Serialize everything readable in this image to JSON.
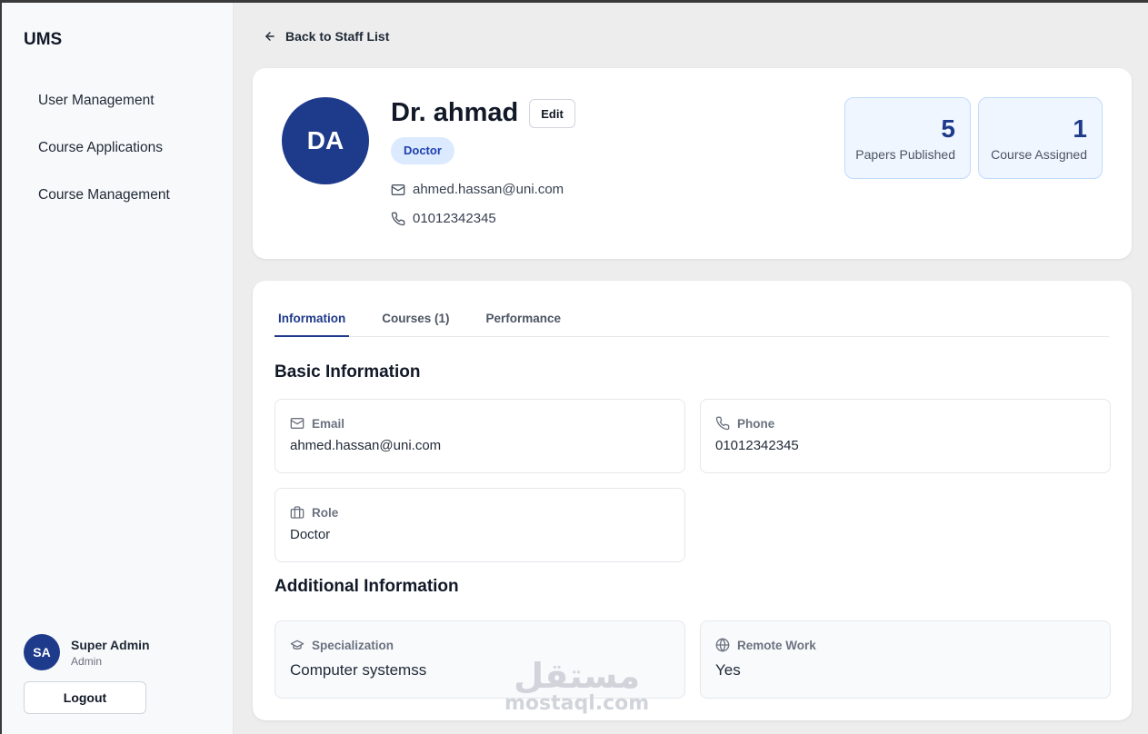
{
  "sidebar": {
    "brand": "UMS",
    "items": [
      {
        "label": "User Management"
      },
      {
        "label": "Course Applications"
      },
      {
        "label": "Course Management"
      }
    ],
    "user": {
      "initials": "SA",
      "name": "Super Admin",
      "role": "Admin"
    },
    "logout_label": "Logout"
  },
  "header": {
    "back_label": "Back to Staff List"
  },
  "profile": {
    "initials": "DA",
    "name": "Dr. ahmad",
    "edit_label": "Edit",
    "role_badge": "Doctor",
    "email": "ahmed.hassan@uni.com",
    "phone": "01012342345",
    "stats": [
      {
        "value": "5",
        "label": "Papers Published"
      },
      {
        "value": "1",
        "label": "Course Assigned"
      }
    ]
  },
  "tabs": [
    {
      "label": "Information",
      "active": true
    },
    {
      "label": "Courses (1)",
      "active": false
    },
    {
      "label": "Performance",
      "active": false
    }
  ],
  "basic_info": {
    "title": "Basic Information",
    "email_label": "Email",
    "email_value": "ahmed.hassan@uni.com",
    "phone_label": "Phone",
    "phone_value": "01012342345",
    "role_label": "Role",
    "role_value": "Doctor"
  },
  "additional_info": {
    "title": "Additional Information",
    "specialization_label": "Specialization",
    "specialization_value": "Computer systemss",
    "remote_label": "Remote Work",
    "remote_value": "Yes"
  },
  "watermark": {
    "arabic": "مستقل",
    "latin": "mostaql.com"
  },
  "colors": {
    "primary": "#1e3a8a",
    "badge_bg": "#dbeafe",
    "stat_bg": "#eff6ff"
  }
}
